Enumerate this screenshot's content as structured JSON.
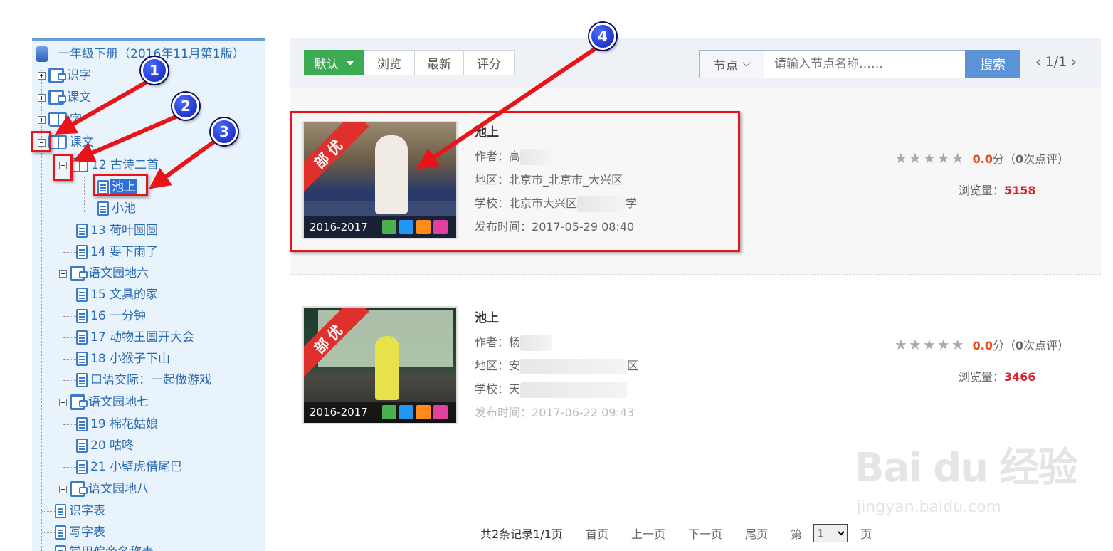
{
  "tree": {
    "root": "一年级下册（2016年11月第1版）",
    "nodes": [
      {
        "label": "识字",
        "icon": "folder-icon"
      },
      {
        "label": "课文",
        "icon": "folder-icon"
      },
      {
        "label": "字",
        "icon": "book-icon"
      },
      {
        "label": "课文",
        "icon": "book-icon"
      },
      {
        "label": "12 古诗二首",
        "icon": "book-icon"
      },
      {
        "label": "池上",
        "icon": "document-icon",
        "selected": true
      },
      {
        "label": "小池",
        "icon": "document-icon"
      },
      {
        "label": "13 荷叶圆圆",
        "icon": "document-icon"
      },
      {
        "label": "14 要下雨了",
        "icon": "document-icon"
      },
      {
        "label": "语文园地六",
        "icon": "folder-icon"
      },
      {
        "label": "15 文具的家",
        "icon": "document-icon"
      },
      {
        "label": "16 一分钟",
        "icon": "document-icon"
      },
      {
        "label": "17 动物王国开大会",
        "icon": "document-icon"
      },
      {
        "label": "18 小猴子下山",
        "icon": "document-icon"
      },
      {
        "label": "口语交际：一起做游戏",
        "icon": "document-icon"
      },
      {
        "label": "语文园地七",
        "icon": "folder-icon"
      },
      {
        "label": "19 棉花姑娘",
        "icon": "document-icon"
      },
      {
        "label": "20 咕咚",
        "icon": "document-icon"
      },
      {
        "label": "21 小壁虎借尾巴",
        "icon": "document-icon"
      },
      {
        "label": "语文园地八",
        "icon": "folder-icon"
      },
      {
        "label": "识字表",
        "icon": "document-icon"
      },
      {
        "label": "写字表",
        "icon": "document-icon"
      },
      {
        "label": "常用偏旁名称表",
        "icon": "document-icon"
      }
    ]
  },
  "toolbar": {
    "sort_default": "默认",
    "sort_browse": "浏览",
    "sort_latest": "最新",
    "sort_score": "评分",
    "node_select": "节点",
    "search_placeholder": "请输入节点名称……",
    "search_button": "搜索",
    "page_current": "1",
    "page_total": "/1"
  },
  "results": [
    {
      "title": "池上",
      "author_label": "作者：",
      "author": "高",
      "region_label": "地区：",
      "region": "北京市_北京市_大兴区",
      "school_label": "学校：",
      "school": "北京市大兴区",
      "school_suffix": "学",
      "date_label": "发布时间：",
      "date": "2017-05-29 08:40",
      "year": "2016-2017",
      "ribbon": "部优",
      "score": "0.0",
      "score_unit": "分（",
      "reviews": "0",
      "reviews_unit": "次点评）",
      "views_label": "浏览量：",
      "views": "5158"
    },
    {
      "title": "池上",
      "author_label": "作者：",
      "author": "杨",
      "region_label": "地区：",
      "region": "安",
      "region_suffix": "区",
      "school_label": "学校：",
      "school": "天",
      "date_label": "发布时间：",
      "date": "2017-06-22 09:43",
      "year": "2016-2017",
      "ribbon": "部优",
      "score": "0.0",
      "score_unit": "分（",
      "reviews": "0",
      "reviews_unit": "次点评）",
      "views_label": "浏览量：",
      "views": "3466"
    }
  ],
  "pager": {
    "summary": "共2条记录1/1页",
    "first": "首页",
    "prev": "上一页",
    "next": "下一页",
    "last": "尾页",
    "goto_prefix": "第",
    "goto_value": "1",
    "goto_suffix": "页"
  },
  "annotations": [
    "1",
    "2",
    "3",
    "4"
  ],
  "watermark": {
    "main": "Bai du 经验",
    "sub": "jingyan.baidu.com"
  },
  "colors": {
    "accent_green": "#3daa54",
    "search_blue": "#5b93d6",
    "annotation_red": "#e8141a",
    "views_red": "#d9232a"
  }
}
